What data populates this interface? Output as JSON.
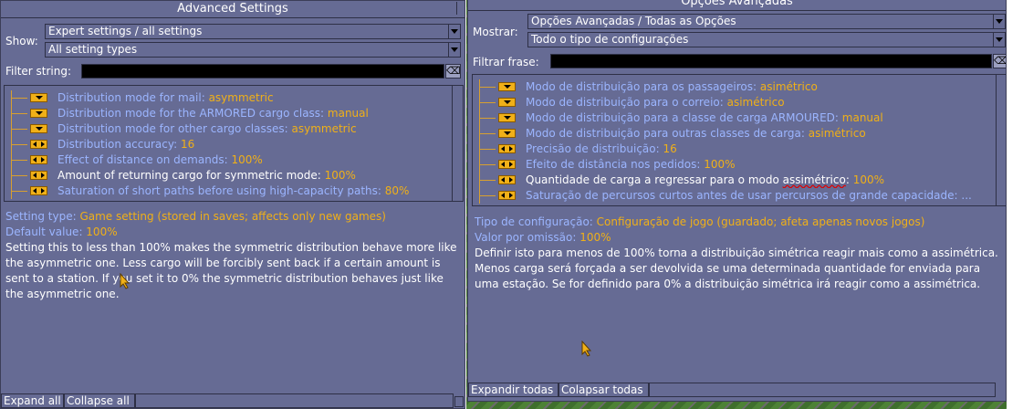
{
  "left": {
    "title": "Advanced Settings",
    "show_label": "Show:",
    "dropdown1": "Expert settings / all settings",
    "dropdown2": "All setting types",
    "filter_label": "Filter string:",
    "filter_value": "",
    "clear_glyph": "⌫",
    "items": [
      {
        "label": "Distribution mode for mail: ",
        "value": "asymmetric",
        "control": "dropdown"
      },
      {
        "label": "Distribution mode for the ARMORED cargo class: ",
        "value": "manual",
        "control": "dropdown"
      },
      {
        "label": "Distribution mode for other cargo classes: ",
        "value": "asymmetric",
        "control": "dropdown"
      },
      {
        "label": "Distribution accuracy: ",
        "value": "16",
        "control": "stepper"
      },
      {
        "label": "Effect of distance on demands: ",
        "value": "100%",
        "control": "stepper"
      },
      {
        "label": "Amount of returning cargo for symmetric mode: ",
        "value": "100%",
        "control": "stepper",
        "selected": true
      },
      {
        "label": "Saturation of short paths before using high-capacity paths: ",
        "value": "80%",
        "control": "stepper"
      }
    ],
    "setting_type_label": "Setting type: ",
    "setting_type_value": "Game setting (stored in saves; affects only new games)",
    "default_label": "Default value: ",
    "default_value": "100%",
    "description": "Setting this to less than 100% makes the symmetric distribution behave more like the asymmetric one. Less cargo will be forcibly sent back if a certain amount is sent to a station. If you set it to 0% the symmetric distribution behaves just like the asymmetric one.",
    "expand_all": "Expand all",
    "collapse_all": "Collapse all"
  },
  "right": {
    "title": "Opções Avançadas",
    "show_label": "Mostrar:",
    "dropdown1": "Opções Avançadas / Todas as Opções",
    "dropdown2": "Todo o tipo de configurações",
    "filter_label": "Filtrar frase:",
    "filter_value": "",
    "clear_glyph": "⌫",
    "items": [
      {
        "label": "Modo de distribuição para os passageiros: ",
        "value": "asimétrico",
        "control": "dropdown"
      },
      {
        "label": "Modo de distribuição para o correio: ",
        "value": "asimétrico",
        "control": "dropdown"
      },
      {
        "label": "Modo de distribuição para a classe de carga ARMOURED: ",
        "value": "manual",
        "control": "dropdown"
      },
      {
        "label": "Modo de distribuição para outras classes de carga: ",
        "value": "asimétrico",
        "control": "dropdown"
      },
      {
        "label": "Precisão de distribuição: ",
        "value": "16",
        "control": "stepper"
      },
      {
        "label": "Efeito de distância nos pedidos: ",
        "value": "100%",
        "control": "stepper"
      },
      {
        "label_before": "Quantidade de carga a regressar para o modo ",
        "label_marked": "assimétrico",
        "label_after": ": ",
        "value": "100%",
        "control": "stepper",
        "selected": true
      },
      {
        "label": "Saturação de percursos curtos antes de usar percursos de grande capacidade: ...",
        "value": "",
        "control": "stepper"
      }
    ],
    "setting_type_label": "Tipo de configuração: ",
    "setting_type_value": "Configuração de jogo (guardado; afeta apenas novos jogos)",
    "default_label": "Valor por omissão: ",
    "default_value": "100%",
    "description": "Definir isto para menos de 100% torna a distribuição simétrica reagir mais como a assimétrica. Menos carga será forçada a ser devolvida se uma determinada quantidade for enviada para uma estação. Se for definido para 0% a distribuição simétrica irá reagir como a assimétrica.",
    "expand_all": "Expandir todas",
    "collapse_all": "Colapsar todas"
  }
}
